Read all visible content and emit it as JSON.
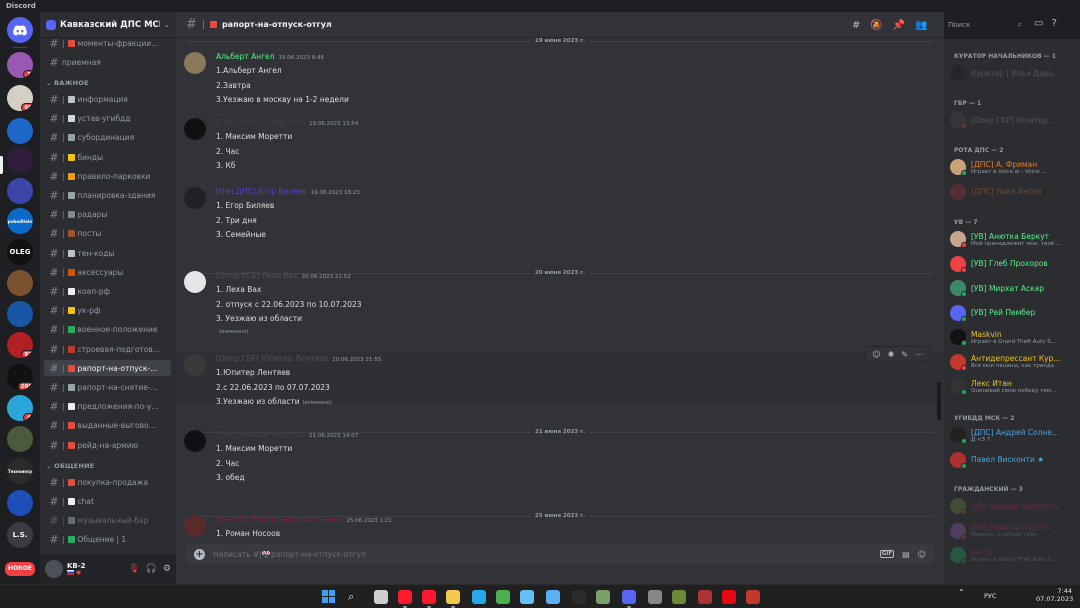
{
  "window": {
    "title": "Discord"
  },
  "servers": [
    {
      "label": "",
      "badge": "2",
      "color": "#9b59b6"
    },
    {
      "label": "",
      "badge": "69",
      "color": "#d6d0c4"
    },
    {
      "label": "",
      "badge": "",
      "color": "#1e66c8"
    },
    {
      "label": "",
      "badge": "",
      "color": "#2f1d3a"
    },
    {
      "label": "",
      "badge": "",
      "color": "#3b47a8"
    },
    {
      "label": "pobeditelo",
      "badge": "",
      "color": "#0b69c7"
    },
    {
      "label": "OLEG",
      "badge": "",
      "color": "#111111"
    },
    {
      "label": "",
      "badge": "",
      "color": "#7a5230"
    },
    {
      "label": "",
      "badge": "",
      "color": "#1957a6"
    },
    {
      "label": "",
      "badge": "97",
      "color": "#b21f24"
    },
    {
      "label": "",
      "badge": "280",
      "color": "#111111"
    },
    {
      "label": "",
      "badge": "4",
      "color": "#2aa7d8"
    },
    {
      "label": "",
      "badge": "",
      "color": "#4b5a3a"
    },
    {
      "label": "Техноингр",
      "badge": "",
      "color": "#2b2b2b"
    },
    {
      "label": "",
      "badge": "",
      "color": "#1d4fb8"
    },
    {
      "label": "L.S.",
      "badge": "",
      "color": "#3a3c42"
    }
  ],
  "new_button": "НОВОЕ",
  "guild": {
    "name": "Кавказский ДПС МСК"
  },
  "channels_top": [
    {
      "name": "моменты-фракции...",
      "emoji_color": "#e74c3c"
    },
    {
      "name": "приемная",
      "emoji_color": ""
    }
  ],
  "categories": [
    {
      "name": "ВАЖНОЕ"
    },
    {
      "name": "ОБЩЕНИЕ"
    }
  ],
  "channels_important": [
    {
      "name": "информация",
      "emoji_color": "#bdc3c7"
    },
    {
      "name": "устав-угибдд",
      "emoji_color": "#cfd8dc"
    },
    {
      "name": "субординация",
      "emoji_color": "#95a5a6"
    },
    {
      "name": "бинды",
      "emoji_color": "#f1c40f"
    },
    {
      "name": "правило-парковки",
      "emoji_color": "#f39c12"
    },
    {
      "name": "планировка-здания",
      "emoji_color": "#95a5a6"
    },
    {
      "name": "радары",
      "emoji_color": "#7f8c8d"
    },
    {
      "name": "посты",
      "emoji_color": "#a0522d"
    },
    {
      "name": "тен-коды",
      "emoji_color": "#bdc3c7"
    },
    {
      "name": "аксессуары",
      "emoji_color": "#d35400"
    },
    {
      "name": "коап-рф",
      "emoji_color": "#ecf0f1"
    },
    {
      "name": "ук-рф",
      "emoji_color": "#f1c40f"
    },
    {
      "name": "военное-положение",
      "emoji_color": "#27ae60"
    },
    {
      "name": "строевая-подготов...",
      "emoji_color": "#c0392b"
    },
    {
      "name": "рапорт-на-отпуск-...",
      "emoji_color": "#e74c3c"
    },
    {
      "name": "рапорт-на-снятие-...",
      "emoji_color": "#95a5a6"
    },
    {
      "name": "предложения-по-у...",
      "emoji_color": "#ecf0f1"
    },
    {
      "name": "выданные-выгово...",
      "emoji_color": "#e74c3c"
    },
    {
      "name": "рейд-на-армию",
      "emoji_color": "#e74c3c"
    }
  ],
  "channels_general": [
    {
      "name": "покупка-продажа",
      "emoji_color": "#e74c3c"
    },
    {
      "name": "chat",
      "emoji_color": "#ecf0f1"
    },
    {
      "name": "музыкальный-бар",
      "emoji_color": "#95a5a6"
    },
    {
      "name": "Общение | 1",
      "emoji_color": "#27ae60"
    }
  ],
  "user": {
    "name": "KB-2",
    "flags": ""
  },
  "current_channel": {
    "name": "рапорт-на-отпуск-отгул"
  },
  "dates": [
    "19 июня 2023 г.",
    "20 июня 2023 г.",
    "21 июня 2023 г.",
    "25 июня 2023 г."
  ],
  "messages": [
    {
      "author": "Альберт Ангел",
      "color": "#57f287",
      "ts": "19.06.2023 8:46",
      "lines": [
        "1.Альберт Ангел",
        "2.Завтра",
        "3.Уезжаю в москву на 1-2 недели"
      ],
      "edited": "",
      "avatar": "#8a7a5a"
    },
    {
      "author": "[ГБР] Максим Моретти",
      "color": "#3c3f45",
      "ts": "19.06.2023 13:54",
      "lines": [
        "1. Максим Моретти",
        "2. Час",
        "3. Кб"
      ],
      "edited": "",
      "avatar": "#111111"
    },
    {
      "author": "[Нач.ДПС] Егор Биляев",
      "color": "#5a3fc0",
      "ts": "19.06.2023 18:23",
      "lines": [
        "1. Егор Биляев",
        "2. Три дня",
        "3. Семейные"
      ],
      "edited": "",
      "avatar": "#222222"
    },
    {
      "author": "[Опер.УСБ] Леха Вах",
      "color": "#4f5258",
      "ts": "20.06.2023 21:52",
      "lines": [
        "1. Леха Вах",
        "2. отпуск с 22.06.2023 по 10.07.2023",
        "3. Уезжаю из области"
      ],
      "edited": "(изменено)",
      "avatar": "#e6e6e6"
    },
    {
      "author": "[Опер.ГБР] Юпитер Лентяев",
      "color": "#4f5258",
      "ts": "20.06.2023 21:55",
      "lines": [
        "1.Юпитер Лентяев",
        "2.с 22.06.2023 по 07.07.2023",
        "3.Уезжаю из области"
      ],
      "edited": "(изменено)",
      "avatar": "#3a3a3a"
    },
    {
      "author": "[ГБР] Максим Моретти",
      "color": "#3c3f45",
      "ts": "21.06.2023 14:07",
      "lines": [
        "1. Максим Моретти",
        "2. Час",
        "3. обед"
      ],
      "edited": "",
      "avatar": "#111111"
    },
    {
      "author": "[Нач.УВ] Преподаватель Кавказ",
      "color": "#8b1f3a",
      "ts": "25.06.2023 1:21",
      "lines": [
        "1. Роман Носоов"
      ],
      "edited": "",
      "avatar": "#5a2a2a"
    }
  ],
  "composer": {
    "placeholder": "Написать #|🎌рапорт-на-отпуск-отгул",
    "gif": "GIF"
  },
  "search": {
    "placeholder": "Поиск"
  },
  "member_groups": [
    {
      "title": "КУРАТОР НАЧАЛЬНИКОВ — 1",
      "members": [
        {
          "name": "Куратор [ Илья Дарь...",
          "status": "",
          "color": "#949ba4",
          "dot": "",
          "av": "#1a1a1a",
          "off": true
        }
      ]
    },
    {
      "title": "ГБР — 1",
      "members": [
        {
          "name": "[Опер.ГБР] Юпитер ...",
          "status": "",
          "color": "#949ba4",
          "dot": "#f23f43",
          "av": "#4a4a4a",
          "off": true
        }
      ]
    },
    {
      "title": "РОТА ДПС — 2",
      "members": [
        {
          "name": "[ДПС] А. Фриман",
          "status": "Играет в Voice.ai - Voice ...",
          "color": "#e67e22",
          "dot": "#23a55a",
          "av": "#c9a27a",
          "off": false
        },
        {
          "name": "[ДПС] Лика Ангел",
          "status": "",
          "color": "#e67e22",
          "dot": "",
          "av": "#a33",
          "off": true
        }
      ]
    },
    {
      "title": "УВ — 7",
      "members": [
        {
          "name": "[УВ] Анютка Беркут",
          "status": "Мой принадлежит мне, твоё ...",
          "color": "#57f287",
          "dot": "#f23f43",
          "av": "#c7a58f",
          "off": false
        },
        {
          "name": "[УВ] Глеб Прохоров",
          "status": "",
          "color": "#57f287",
          "dot": "#f23f43",
          "av": "#ed4245",
          "off": false
        },
        {
          "name": "[УВ] Мирхат Аскар",
          "status": "",
          "color": "#57f287",
          "dot": "#23a55a",
          "av": "#3a8a6a",
          "off": false
        },
        {
          "name": "[УВ] Рей Пембер",
          "status": "",
          "color": "#57f287",
          "dot": "#23a55a",
          "av": "#5865f2",
          "off": false
        },
        {
          "name": "Maskvin",
          "status": "Играет в Grand Theft Auto S...",
          "color": "#f1c40f",
          "dot": "#23a55a",
          "av": "#111111",
          "off": false
        },
        {
          "name": "Антидепрессант Кур...",
          "status": "Все мои пацаны, как тринда",
          "color": "#f1c40f",
          "dot": "#f23f43",
          "av": "#c0392b",
          "off": false
        },
        {
          "name": "Лекс Итан",
          "status": "Оценивай свою победу тем,...",
          "color": "#f1c40f",
          "dot": "#23a55a",
          "av": "#333333",
          "off": false
        }
      ]
    },
    {
      "title": "УГИБДД МСК — 2",
      "members": [
        {
          "name": "[ДПС] Андрей Солне...",
          "status": "Д <3 ?",
          "color": "#4aa3df",
          "dot": "#23a55a",
          "av": "#222222",
          "off": false
        },
        {
          "name": "Павел Висконти ★",
          "status": "",
          "color": "#4aa3df",
          "dot": "#23a55a",
          "av": "#b03030",
          "off": false
        }
      ]
    },
    {
      "title": "ГРАЖДАНСКИЙ — 3",
      "members": [
        {
          "name": "[УВ] Андрей Черлипп...",
          "status": "",
          "color": "#e91e63",
          "dot": "#f23f43",
          "av": "#6a8a3a",
          "off": true
        },
        {
          "name": "[УВ] Майклы Курсол...",
          "status": "Майкли, я люблю тебя",
          "color": "#e91e63",
          "dot": "#f23f43",
          "av": "#9b59b6",
          "off": true
        },
        {
          "name": "bar18",
          "status": "Играет в Grand Theft Auto S...",
          "color": "#e91e63",
          "dot": "#23a55a",
          "av": "#23a55a",
          "off": true
        }
      ]
    }
  ],
  "tray": {
    "lang": "РУС",
    "time": "7:44",
    "date": "07.07.2023"
  }
}
